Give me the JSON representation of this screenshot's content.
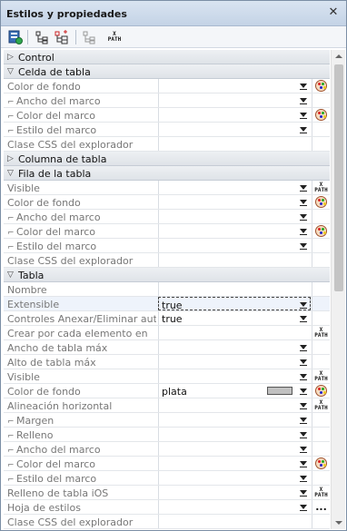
{
  "window": {
    "title": "Estilos y propiedades",
    "close_label": "✕"
  },
  "toolbar": {
    "icons": [
      "apply-to-icon",
      "tree-view-icon",
      "tree-expand-icon",
      "tree-collapse-icon",
      "xpath-icon"
    ],
    "xpath_label": "X\nPATH"
  },
  "sections": {
    "control": "Control",
    "celda": "Celda de tabla",
    "columna": "Columna de tabla",
    "fila": "Fila de la tabla",
    "tabla": "Tabla"
  },
  "rows": {
    "celda_color_fondo": "Color de fondo",
    "celda_ancho_marco": "Ancho del marco",
    "celda_color_marco": "Color del marco",
    "celda_estilo_marco": "Estilo del marco",
    "celda_clase_css": "Clase CSS del explorador",
    "fila_visible": "Visible",
    "fila_color_fondo": "Color de fondo",
    "fila_ancho_marco": "Ancho del marco",
    "fila_color_marco": "Color del marco",
    "fila_estilo_marco": "Estilo del marco",
    "fila_clase_css": "Clase CSS del explorador",
    "tabla_nombre": "Nombre",
    "tabla_extensible": "Extensible",
    "tabla_controles": "Controles Anexar/Eliminar aut...",
    "tabla_crear": "Crear por cada elemento en",
    "tabla_ancho_max": "Ancho de tabla máx",
    "tabla_alto_max": "Alto de tabla máx",
    "tabla_visible": "Visible",
    "tabla_color_fondo": "Color de fondo",
    "tabla_alineacion": "Alineación horizontal",
    "tabla_margen": "Margen",
    "tabla_relleno": "Relleno",
    "tabla_ancho_marco": "Ancho del marco",
    "tabla_color_marco": "Color del marco",
    "tabla_estilo_marco": "Estilo del marco",
    "tabla_relleno_ios": "Relleno de tabla iOS",
    "tabla_hoja_estilos": "Hoja de estilos",
    "tabla_clase_css": "Clase CSS del explorador"
  },
  "values": {
    "tabla_extensible": "true",
    "tabla_controles": "true",
    "tabla_color_fondo": "plata"
  },
  "labels": {
    "xpath": "XPATH",
    "ellipsis": "..."
  },
  "colors": {
    "swatch_plata": "#c0c0c0",
    "title_bg": "#c9d7e9",
    "section_bg": "#e6e9ed"
  }
}
